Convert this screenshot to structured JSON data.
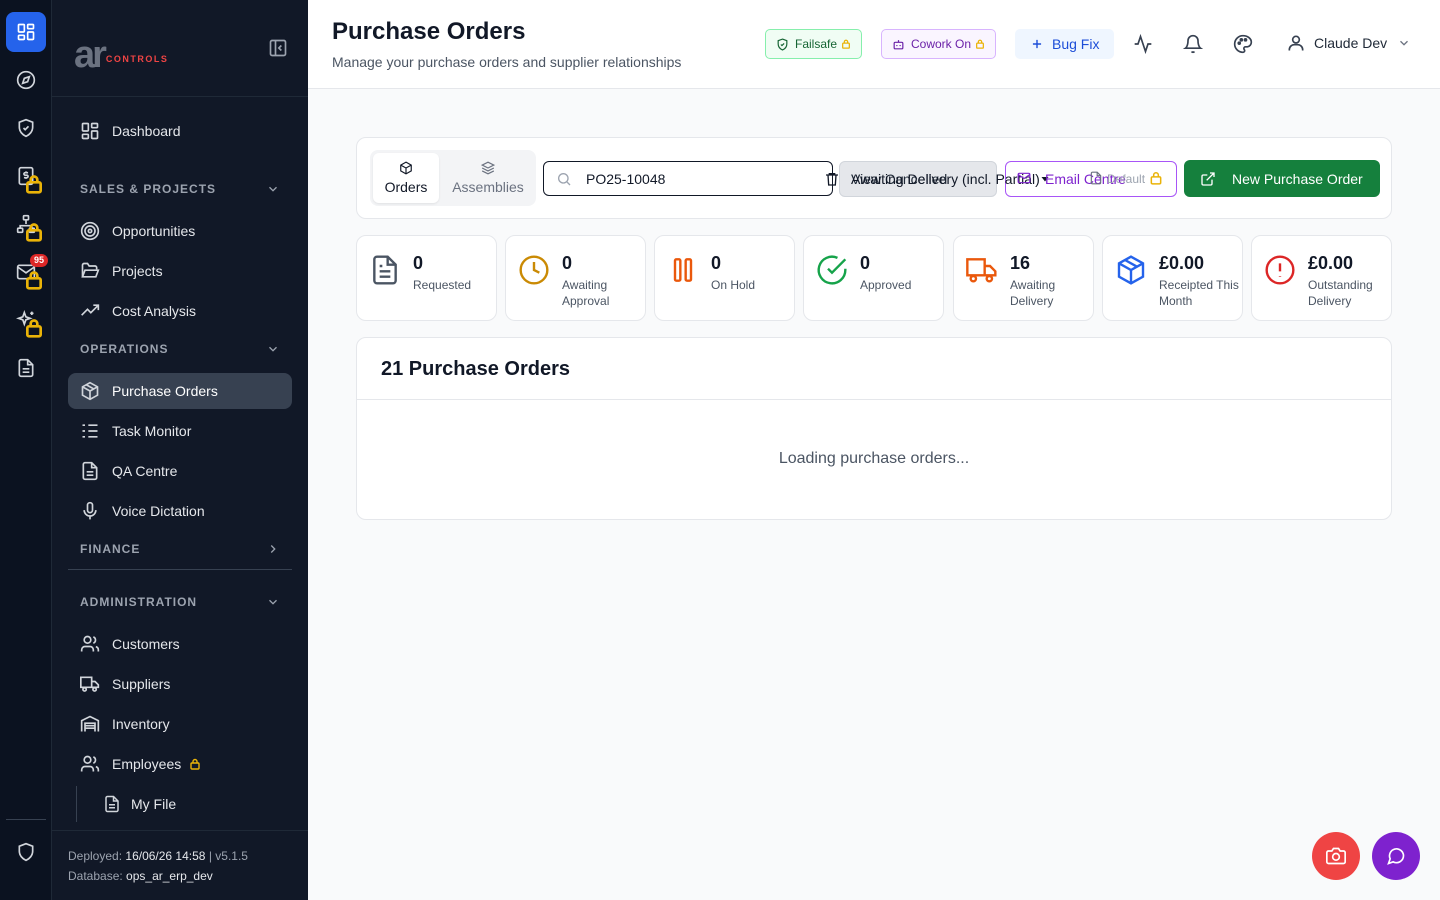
{
  "rail": {
    "mail_badge": "95"
  },
  "sidebar": {
    "logo_text": "ar",
    "logo_sub": "CONTROLS",
    "dashboard": "Dashboard",
    "sections": {
      "sales": "SALES & PROJECTS",
      "operations": "OPERATIONS",
      "finance": "FINANCE",
      "administration": "ADMINISTRATION"
    },
    "items": {
      "opportunities": "Opportunities",
      "projects": "Projects",
      "cost_analysis": "Cost Analysis",
      "purchase_orders": "Purchase Orders",
      "task_monitor": "Task Monitor",
      "qa_centre": "QA Centre",
      "voice_dictation": "Voice Dictation",
      "customers": "Customers",
      "suppliers": "Suppliers",
      "inventory": "Inventory",
      "employees": "Employees",
      "my_file": "My File"
    },
    "footer": {
      "deployed_label": "Deployed:",
      "deployed_value": "16/06/26 14:58",
      "separator": "|",
      "version": "v5.1.5",
      "database_label": "Database:",
      "database_value": "ops_ar_erp_dev"
    }
  },
  "header": {
    "title": "Purchase Orders",
    "subtitle": "Manage your purchase orders and supplier relationships",
    "failsafe": "Failsafe",
    "cowork": "Cowork On",
    "bugfix": "Bug Fix",
    "user": "Claude Dev"
  },
  "toolbar": {
    "tab_orders": "Orders",
    "tab_assemblies": "Assemblies",
    "search_value": "PO25-10048",
    "overlap_a": "View Cancelled",
    "overlap_b": "Awaiting Delivery (incl. Partial)",
    "overlap_c": "Email Centre",
    "overlap_d": "Default",
    "new_po": "New Purchase Order"
  },
  "stats": [
    {
      "value": "0",
      "label": "Requested"
    },
    {
      "value": "0",
      "label": "Awaiting Approval"
    },
    {
      "value": "0",
      "label": "On Hold"
    },
    {
      "value": "0",
      "label": "Approved"
    },
    {
      "value": "16",
      "label": "Awaiting Delivery"
    },
    {
      "value": "£0.00",
      "label": "Receipted This Month"
    },
    {
      "value": "£0.00",
      "label": "Outstanding Delivery"
    }
  ],
  "orders": {
    "title": "21 Purchase Orders",
    "loading": "Loading purchase orders..."
  },
  "colors": {
    "accent_blue": "#2563eb",
    "primary_green": "#15803d",
    "email_purple": "#a855f7",
    "fab_red": "#ef4444",
    "fab_purple": "#7e22ce"
  }
}
